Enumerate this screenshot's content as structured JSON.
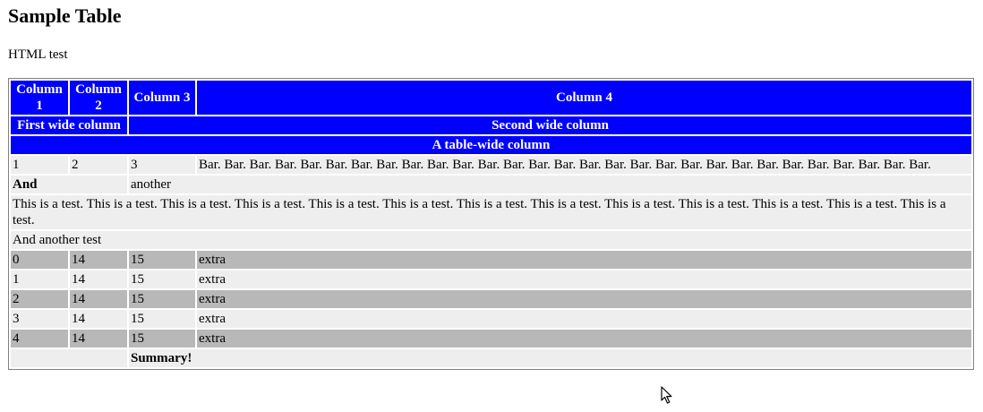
{
  "page": {
    "title": "Sample Table",
    "subtitle": "HTML test"
  },
  "table": {
    "headers": [
      "Column 1",
      "Column 2",
      "Column 3",
      "Column 4"
    ],
    "wide_headers": [
      "First wide column",
      "Second wide column"
    ],
    "table_wide_header": "A table-wide column",
    "row1": {
      "c1": "1",
      "c2": "2",
      "c3": "3",
      "c4": "Bar. Bar. Bar. Bar. Bar. Bar. Bar. Bar. Bar. Bar. Bar. Bar. Bar. Bar. Bar. Bar. Bar. Bar. Bar. Bar. Bar. Bar. Bar. Bar. Bar. Bar. Bar. Bar. Bar."
    },
    "row2": {
      "c1": "And",
      "c2": "another"
    },
    "long_text": "This is a test. This is a test. This is a test. This is a test. This is a test. This is a test. This is a test. This is a test. This is a test. This is a test. This is a test. This is a test. This is a test.",
    "another_test": "And another test",
    "data_rows": [
      {
        "a": "0",
        "b": "14",
        "c": "15",
        "d": "extra"
      },
      {
        "a": "1",
        "b": "14",
        "c": "15",
        "d": "extra"
      },
      {
        "a": "2",
        "b": "14",
        "c": "15",
        "d": "extra"
      },
      {
        "a": "3",
        "b": "14",
        "c": "15",
        "d": "extra"
      },
      {
        "a": "4",
        "b": "14",
        "c": "15",
        "d": "extra"
      }
    ],
    "summary": "Summary!"
  },
  "icons": {
    "cursor": "mouse-pointer-icon"
  },
  "colors": {
    "header_bg": "#0000ff",
    "header_text": "#ffffff",
    "cell_light": "#eeeeee",
    "cell_dark": "#b8b8b8"
  }
}
